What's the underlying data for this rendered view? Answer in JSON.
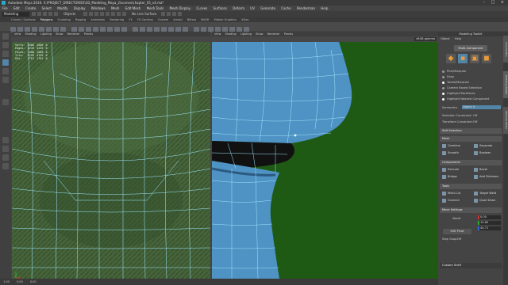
{
  "window": {
    "title": "Autodesk Maya 2016: X:\\PROJECT_DIRECTORIES\\3D_Modeling_Maya_2\\scenes\\chapter_05_v4.ma*",
    "controls": [
      "–",
      "□",
      "×"
    ]
  },
  "menubar": {
    "items": [
      "File",
      "Edit",
      "Create",
      "Select",
      "Modify",
      "Display",
      "Windows",
      "Mesh",
      "Edit Mesh",
      "Mesh Tools",
      "Mesh Display",
      "Curves",
      "Surfaces",
      "Deform",
      "UV",
      "Generate",
      "Cache",
      "Renderman",
      "Help"
    ]
  },
  "shelf": {
    "mode": "Modeling",
    "objects_label": "Objects",
    "no_live_surface": "No Live Surface",
    "tabs": [
      "Curves / Surfaces",
      "Polygons",
      "Sculpting",
      "Rigging",
      "Animation",
      "Rendering",
      "FX",
      "FX Caching",
      "Custom",
      "Arnold",
      "Bifrost",
      "MASH",
      "Motion Graphics",
      "XGen"
    ]
  },
  "panel_menus": [
    "View",
    "Shading",
    "Lighting",
    "Show",
    "Renderer",
    "Panels"
  ],
  "hud": {
    "rows": [
      {
        "label": "Verts:",
        "a": "1666",
        "b": "1666",
        "c": "0"
      },
      {
        "label": "Edges:",
        "a": "3245",
        "b": "3245",
        "c": "0"
      },
      {
        "label": "Faces:",
        "a": "1600",
        "b": "1600",
        "c": "0"
      },
      {
        "label": "Tris:",
        "a": "3195",
        "b": "3195",
        "c": "0"
      },
      {
        "label": "UVs:",
        "a": "1761",
        "b": "1761",
        "c": "0"
      }
    ]
  },
  "right_view_label": "sRGB gamma",
  "status": {
    "values": [
      "1.00",
      "0.00",
      "0.00"
    ]
  },
  "tool_panel": {
    "title": "Modeling Toolkit",
    "menu": [
      "Object",
      "Help"
    ],
    "multi_component": "Multi-Component",
    "options": [
      "Pick/Marquee",
      "Drag",
      "Tweak/Marquee",
      "Camera Based Selection",
      "Highlight Backfaces",
      "Highlight Nearest Component"
    ],
    "symmetry_label": "Symmetry:",
    "symmetry_value": "Object X",
    "selection_constraint_label": "Selection Constraint:",
    "selection_constraint_value": "Off",
    "transform_constraint_label": "Transform Constraint:",
    "transform_constraint_value": "Off",
    "soft_selection": "Soft Selection",
    "mesh_header": "Mesh",
    "mesh_buttons": [
      "Combine",
      "Separate",
      "Smooth",
      "Boolean"
    ],
    "components_header": "Components",
    "component_buttons": [
      "Extrude",
      "Bevel",
      "Bridge",
      "Add Divisions"
    ],
    "tools_header": "Tools",
    "tool_buttons": [
      "Multi-Cut",
      "Target Weld",
      "Connect",
      "Quad Draw"
    ],
    "move_settings_header": "Move Settings",
    "coord_label": "World",
    "xyz": [
      "0.00",
      "10.85",
      "44.71"
    ],
    "edit_pivot": "Edit Pivot",
    "step_snap_label": "Step Snap:",
    "step_snap_value": "Off",
    "custom_shelf": "Custom Shelf"
  },
  "side_tabs": [
    "Channel Box",
    "Modeling Toolkit",
    "Attribute Editor"
  ],
  "colors": {
    "left_bg": "#3d5a32",
    "right_bg": "#1f5a14",
    "mesh": "#4f92c4",
    "wire": "#9ee8ff",
    "accent": "#5285a6"
  }
}
